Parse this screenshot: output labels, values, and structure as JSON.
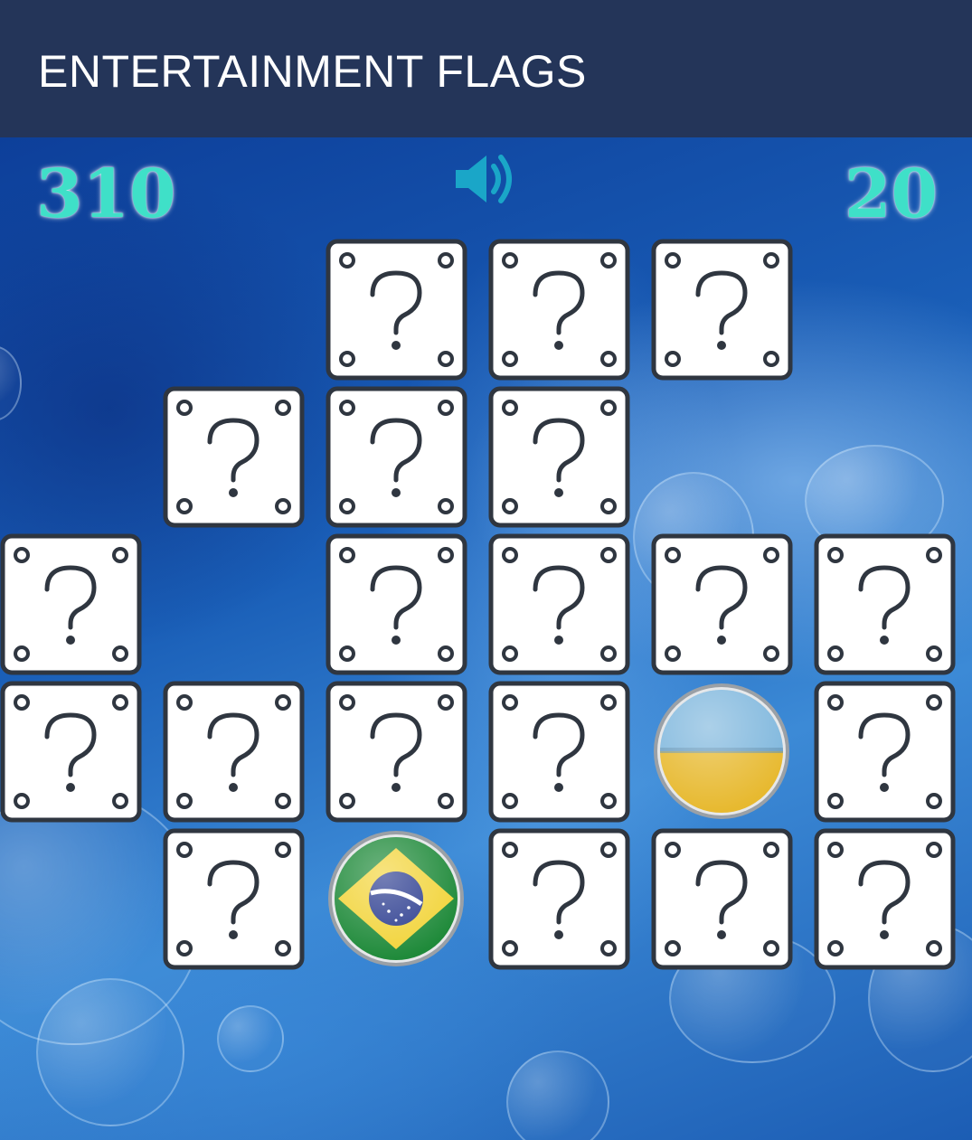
{
  "app": {
    "title": "ENTERTAINMENT FLAGS"
  },
  "hud": {
    "score": "310",
    "moves": "20",
    "sound_icon": "speaker-volume-icon"
  },
  "board": {
    "columns": 6,
    "rows": 5,
    "tile_face_icon": "question-mark-icon",
    "tiles": [
      {
        "row": 0,
        "col": 2,
        "state": "hidden"
      },
      {
        "row": 0,
        "col": 3,
        "state": "hidden"
      },
      {
        "row": 0,
        "col": 4,
        "state": "hidden"
      },
      {
        "row": 1,
        "col": 1,
        "state": "hidden"
      },
      {
        "row": 1,
        "col": 2,
        "state": "hidden"
      },
      {
        "row": 1,
        "col": 3,
        "state": "hidden"
      },
      {
        "row": 2,
        "col": 0,
        "state": "hidden"
      },
      {
        "row": 2,
        "col": 2,
        "state": "hidden"
      },
      {
        "row": 2,
        "col": 3,
        "state": "hidden"
      },
      {
        "row": 2,
        "col": 4,
        "state": "hidden"
      },
      {
        "row": 2,
        "col": 5,
        "state": "hidden"
      },
      {
        "row": 3,
        "col": 0,
        "state": "hidden"
      },
      {
        "row": 3,
        "col": 1,
        "state": "hidden"
      },
      {
        "row": 3,
        "col": 2,
        "state": "hidden"
      },
      {
        "row": 3,
        "col": 3,
        "state": "hidden"
      },
      {
        "row": 3,
        "col": 4,
        "state": "revealed",
        "flag": "ukraine-flag-icon"
      },
      {
        "row": 3,
        "col": 5,
        "state": "hidden"
      },
      {
        "row": 4,
        "col": 1,
        "state": "hidden"
      },
      {
        "row": 4,
        "col": 2,
        "state": "revealed",
        "flag": "brazil-flag-icon"
      },
      {
        "row": 4,
        "col": 3,
        "state": "hidden"
      },
      {
        "row": 4,
        "col": 4,
        "state": "hidden"
      },
      {
        "row": 4,
        "col": 5,
        "state": "hidden"
      }
    ]
  },
  "colors": {
    "appbar": "#243559",
    "hud_text": "#3fe0c8",
    "sound_icon": "#1aa6c8",
    "tile_face": "#ffffff",
    "tile_border": "#2f3640"
  }
}
